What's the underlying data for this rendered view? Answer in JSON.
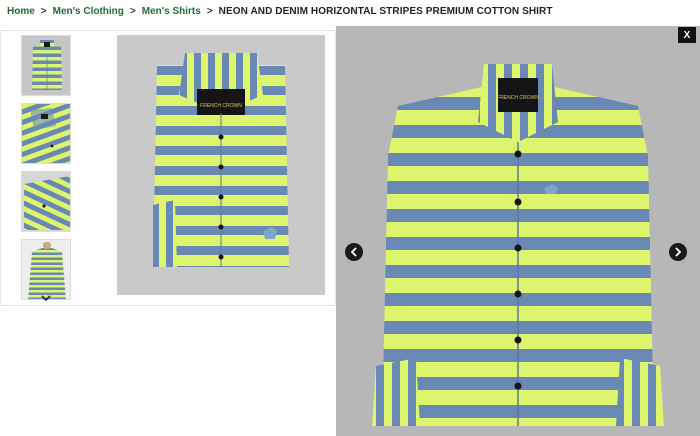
{
  "breadcrumb": {
    "items": [
      "Home",
      "Men's Clothing",
      "Men's Shirts"
    ],
    "separator": ">",
    "current": "NEON AND DENIM HORIZONTAL STRIPES PREMIUM COTTON SHIRT"
  },
  "brand_label": "FRENCH CROWN",
  "zoom_viewer": {
    "close_label": "X",
    "prev_icon": "chevron-left-icon",
    "next_icon": "chevron-right-icon"
  },
  "thumbnails": {
    "count": 4,
    "selected": 1,
    "scroll_icon": "chevron-down-icon"
  },
  "colors": {
    "neon": "#ddf56c",
    "denim": "#6a88b4",
    "link_green": "#1f6b3a",
    "backdrop": "#c9c9c9"
  }
}
